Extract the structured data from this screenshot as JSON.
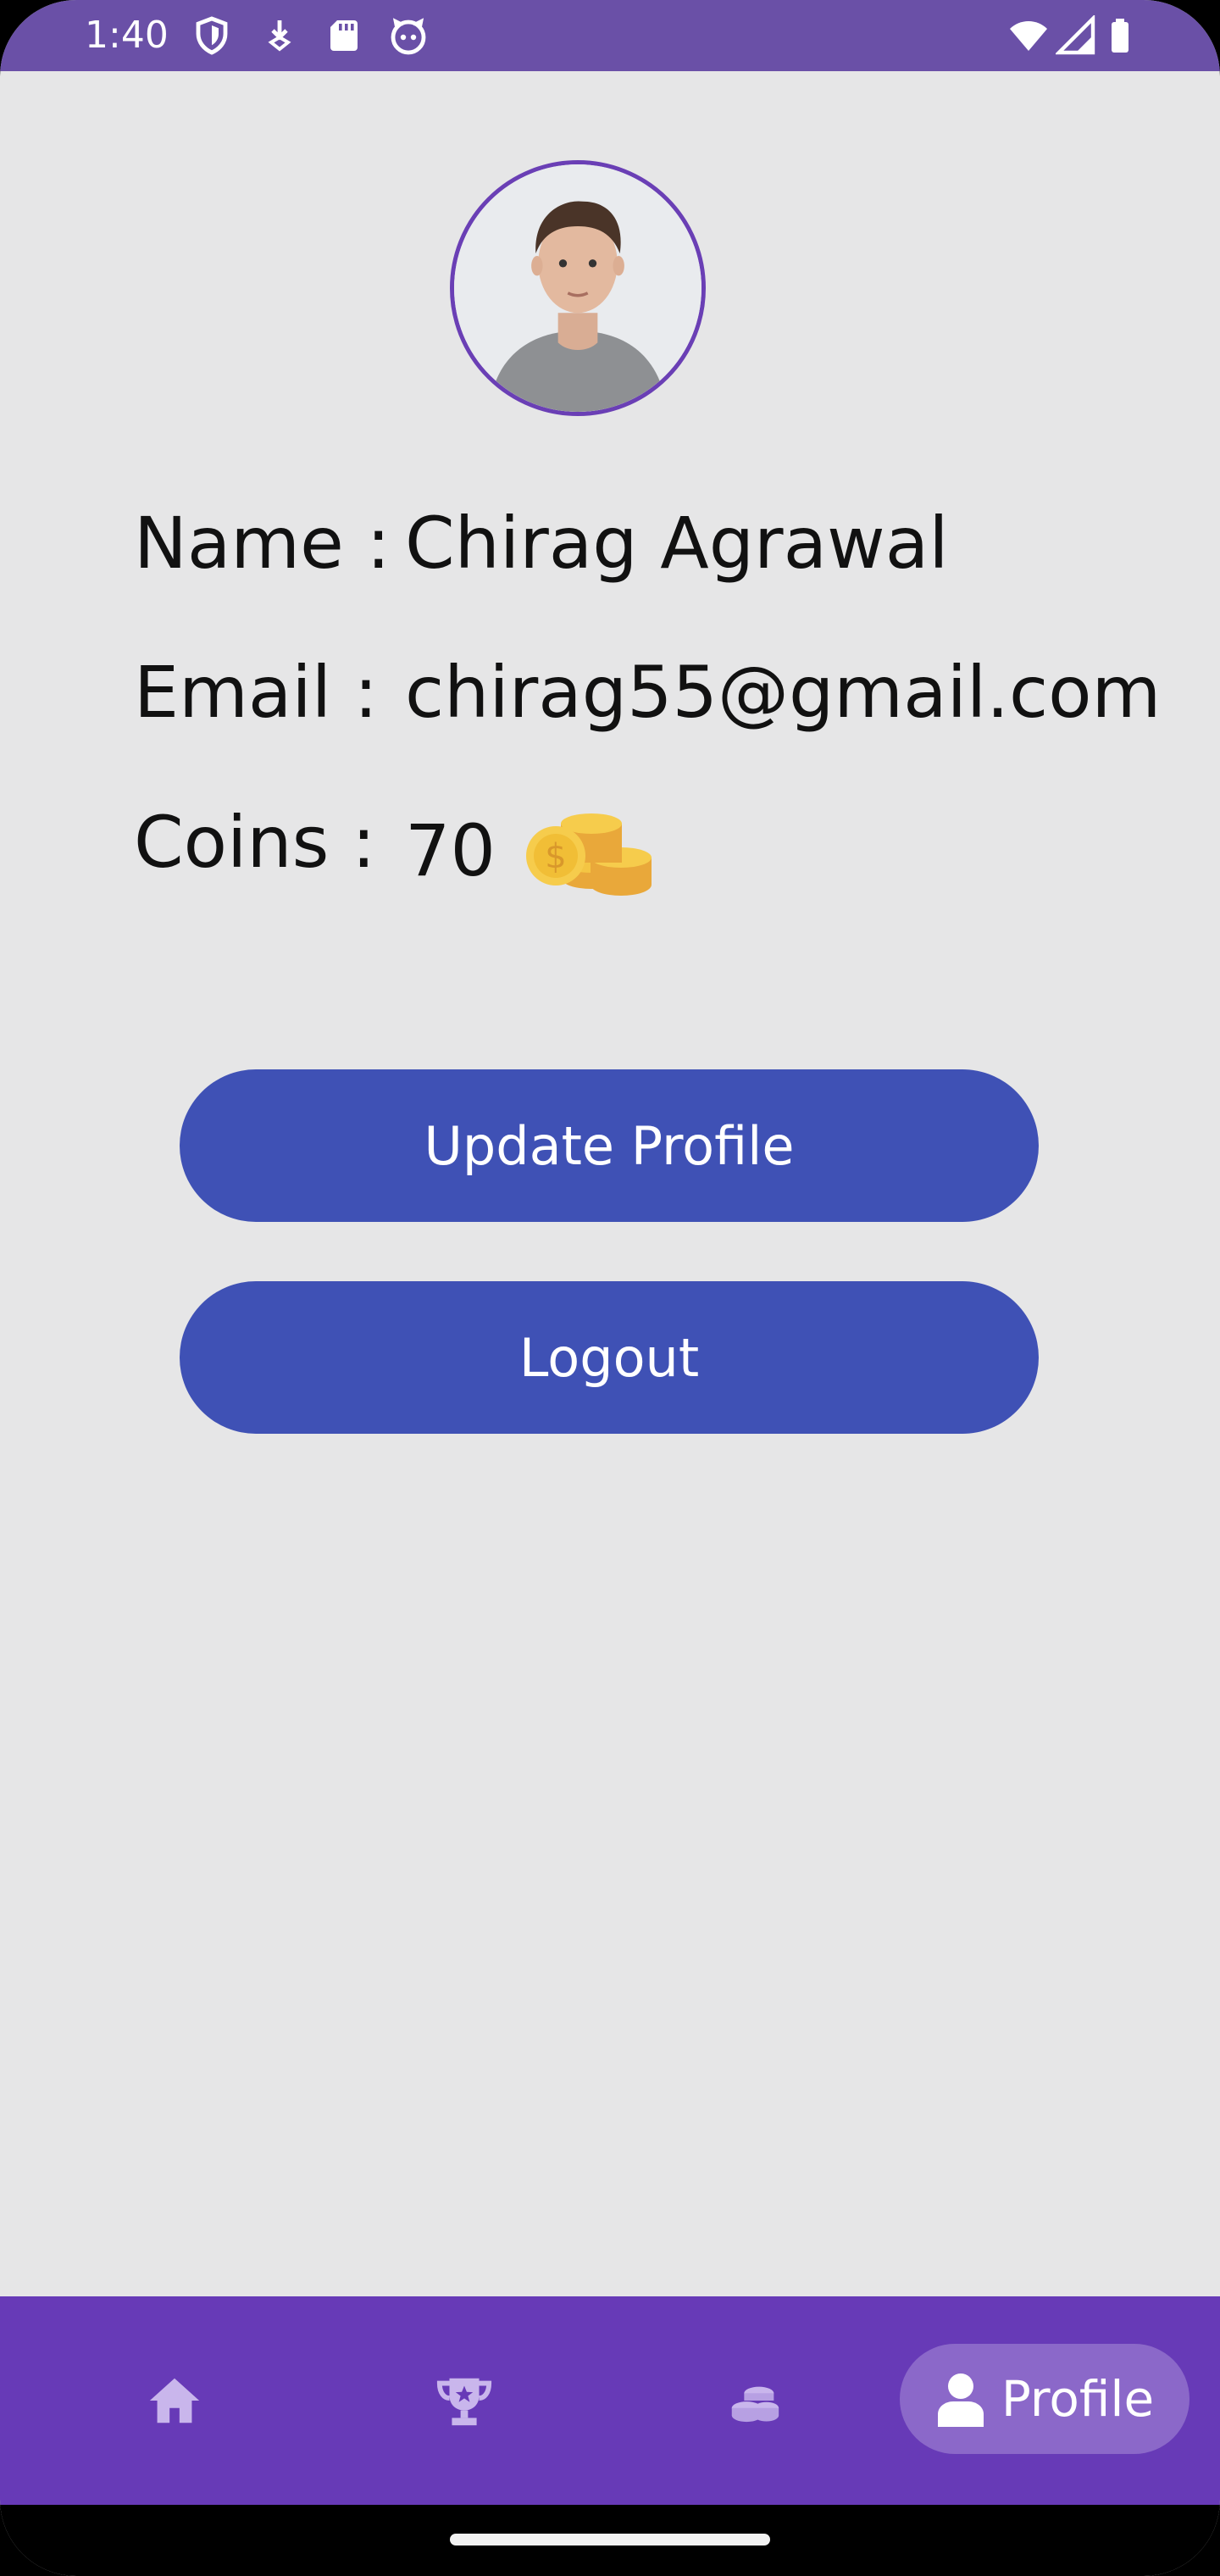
{
  "status_bar": {
    "time": "1:40",
    "left_icons": [
      "shield-icon",
      "download-icon",
      "sd-card-icon",
      "cat-face-icon"
    ],
    "right_icons": [
      "wifi-icon",
      "signal-icon",
      "battery-icon"
    ]
  },
  "profile": {
    "avatar": "user-photo",
    "name_label": "Name :",
    "name_value": "Chirag Agrawal",
    "email_label": "Email :",
    "email_value": "chirag55@gmail.com",
    "coins_label": "Coins :",
    "coins_value": "70",
    "coins_icon": "coin-stack-icon"
  },
  "actions": {
    "update_label": "Update Profile",
    "logout_label": "Logout"
  },
  "bottom_nav": {
    "items": [
      {
        "icon": "home-icon"
      },
      {
        "icon": "trophy-icon"
      },
      {
        "icon": "coins-icon"
      },
      {
        "icon": "person-icon",
        "label": "Profile",
        "active": true
      }
    ]
  },
  "colors": {
    "status_bar": "#6a50a7",
    "background": "#e6e6e7",
    "button": "#3f51b5",
    "bottom_nav": "#673ab7",
    "nav_active_pill": "#8b68c9",
    "avatar_border": "#6a3fb5"
  }
}
